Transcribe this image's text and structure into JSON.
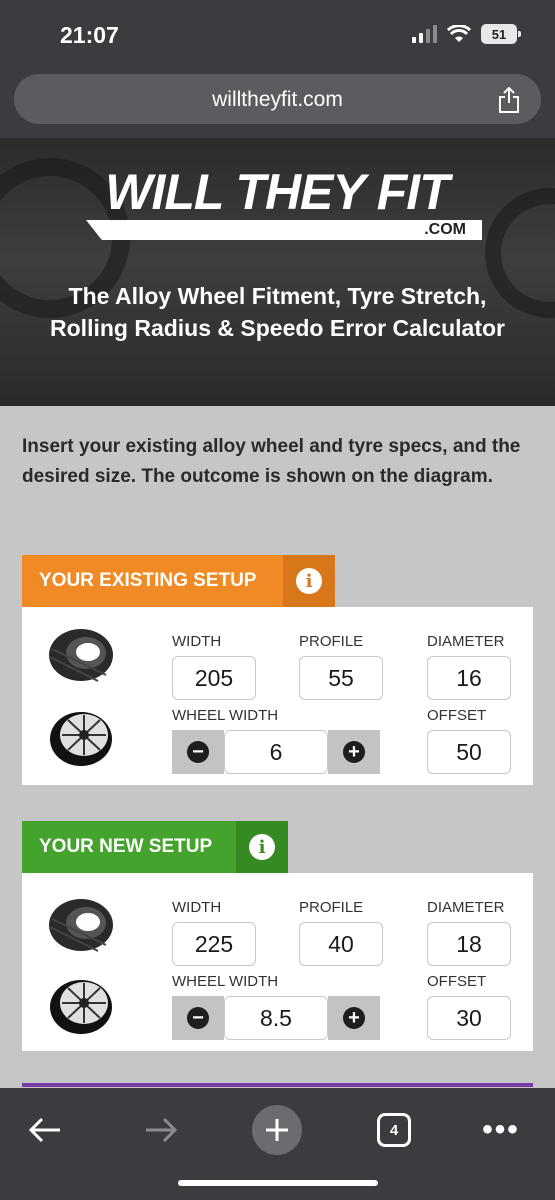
{
  "status_bar": {
    "time": "21:07",
    "battery": "51"
  },
  "browser": {
    "url": "willtheyfit.com",
    "tab_count": "4"
  },
  "hero": {
    "logo_text": "WILL THEY FIT",
    "logo_suffix": ".COM",
    "title": "The Alloy Wheel Fitment, Tyre Stretch, Rolling Radius & Speedo Error Calculator"
  },
  "intro": "Insert your existing alloy wheel and tyre specs, and the desired size. The outcome is shown on the diagram.",
  "existing_setup": {
    "title": "YOUR EXISTING SETUP",
    "color": "#f08a24",
    "info_color": "#d8761a",
    "width_label": "WIDTH",
    "width": "205",
    "profile_label": "PROFILE",
    "profile": "55",
    "diameter_label": "DIAMETER",
    "diameter": "16",
    "wheel_width_label": "WHEEL WIDTH",
    "wheel_width": "6",
    "offset_label": "OFFSET",
    "offset": "50"
  },
  "new_setup": {
    "title": "YOUR NEW SETUP",
    "color": "#43a32c",
    "info_color": "#368a22",
    "width_label": "WIDTH",
    "width": "225",
    "profile_label": "PROFILE",
    "profile": "40",
    "diameter_label": "DIAMETER",
    "diameter": "18",
    "wheel_width_label": "WHEEL WIDTH",
    "wheel_width": "8.5",
    "offset_label": "OFFSET",
    "offset": "30"
  }
}
